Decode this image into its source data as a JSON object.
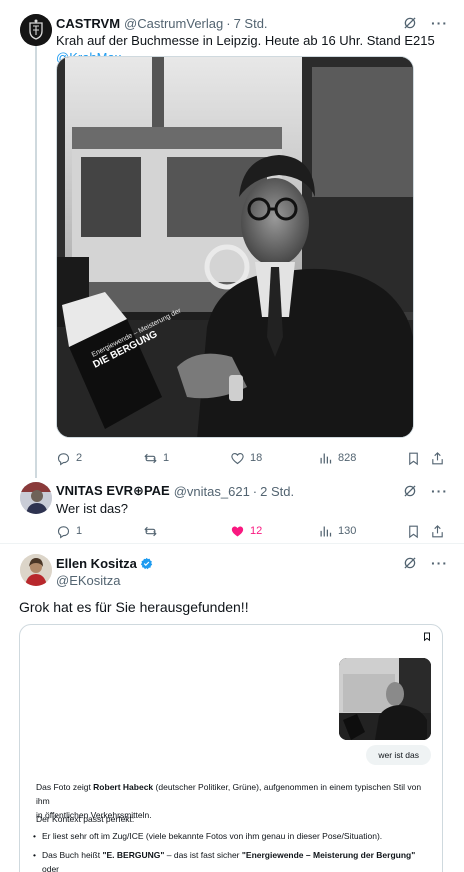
{
  "post1": {
    "name": "CASTRVM",
    "handle": "@CastrumVerlag",
    "time": "7 Std.",
    "text": "Krah auf der Buchmesse in Leipzig. Heute ab 16 Uhr. Stand E215",
    "mention": "@KrahMax",
    "replies": "2",
    "reposts": "1",
    "likes": "18",
    "views": "828",
    "book_title": "DIE BERGUNG",
    "book_sub": "Energiewende – Meisterung der"
  },
  "post2": {
    "name": "VNITAS EVR⊕PAE",
    "handle": "@vnitas_621",
    "time": "2 Std.",
    "text": "Wer ist das?",
    "replies": "1",
    "reposts": "",
    "likes": "12",
    "views": "130"
  },
  "post3": {
    "name": "Ellen Kositza",
    "handle": "@EKositza",
    "text": "Grok hat es für Sie herausgefunden!!"
  },
  "grok": {
    "user_question": "wer ist das",
    "p1_a": "Das Foto zeigt ",
    "p1_b": "Robert Habeck",
    "p1_c": " (deutscher Politiker, Grüne), aufgenommen in einem typischen Stil von ihm",
    "p1_d": "in öffentlichen Verkehrsmitteln.",
    "p2": "Der Kontext passt perfekt:",
    "b1": "Er liest sehr oft im Zug/ICE (viele bekannte Fotos von ihm genau in dieser Pose/Situation).",
    "b2_a": "Das Buch heißt ",
    "b2_b": "\"E. BERGUNG\"",
    "b2_c": " – das ist fast sicher ",
    "b2_d": "\"Energiewende – Meisterung der Bergung\"",
    "b2_e": " oder"
  },
  "colors": {
    "accent": "#1d9bf0",
    "like": "#f91880",
    "muted": "#536471",
    "verified": "#1d9bf0"
  }
}
